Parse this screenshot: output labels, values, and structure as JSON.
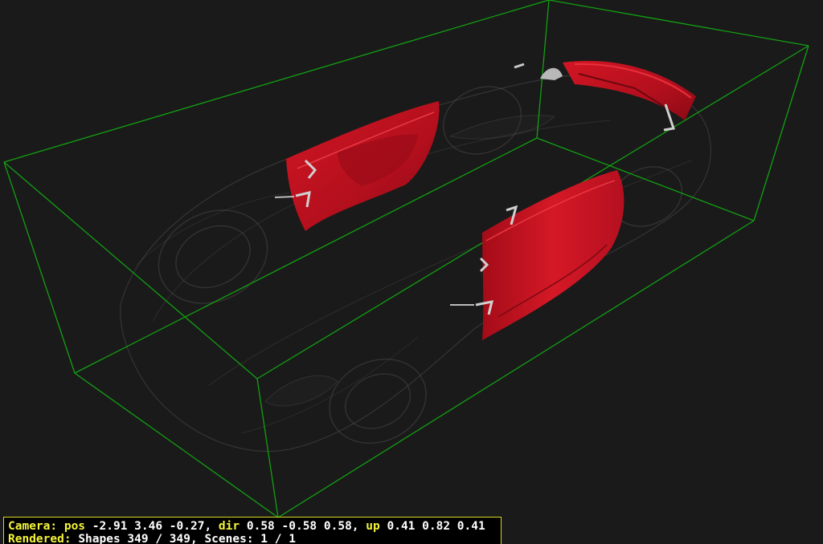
{
  "viewer": {
    "background_color": "#1a1a1a",
    "bounding_box_color": "#12a012",
    "highlight_color": "#c4101e"
  },
  "status": {
    "camera_label": "Camera:",
    "pos_label": "pos",
    "pos_value": "-2.91 3.46 -0.27,",
    "dir_label": "dir",
    "dir_value": "0.58 -0.58 0.58,",
    "up_label": "up",
    "up_value": "0.41 0.82 0.41",
    "rendered_label": "Rendered:",
    "rendered_value": "Shapes 349 / 349, Scenes: 1 / 1"
  }
}
